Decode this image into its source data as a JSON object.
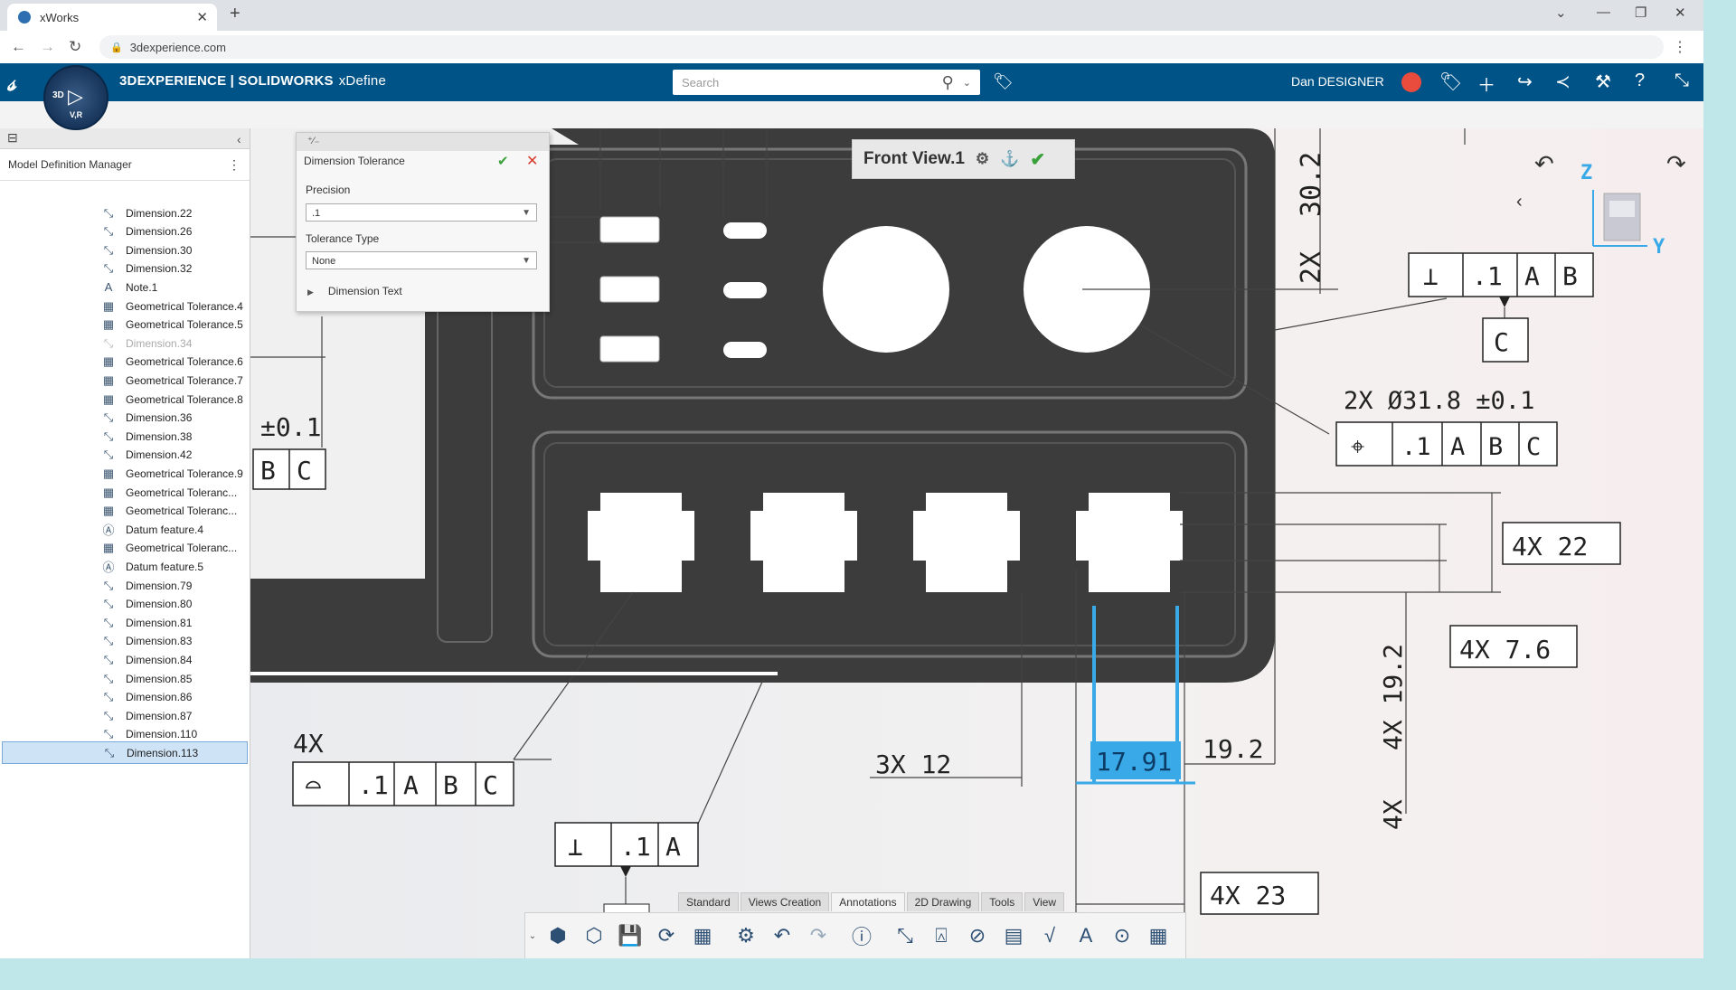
{
  "browser": {
    "tab_title": "xWorks",
    "url": "3dexperience.com"
  },
  "app": {
    "brand_bold": "3DEXPERIENCE | SOLIDWORKS",
    "brand_sub": "xDefine",
    "compass_3d": "3D",
    "compass_vr": "V,R",
    "search_placeholder": "Search",
    "user": "Dan DESIGNER"
  },
  "tree": {
    "title": "Model Definition Manager",
    "items": [
      {
        "label": "Dimension.22",
        "icon": "dimension-icon"
      },
      {
        "label": "Dimension.26",
        "icon": "dimension-icon"
      },
      {
        "label": "Dimension.30",
        "icon": "dimension-icon"
      },
      {
        "label": "Dimension.32",
        "icon": "dimension-icon"
      },
      {
        "label": "Note.1",
        "icon": "note-icon"
      },
      {
        "label": "Geometrical Tolerance.4",
        "icon": "gtol-icon"
      },
      {
        "label": "Geometrical Tolerance.5",
        "icon": "gtol-icon"
      },
      {
        "label": "Dimension.34",
        "icon": "dimension-icon",
        "state": "greyed"
      },
      {
        "label": "Geometrical Tolerance.6",
        "icon": "gtol-icon"
      },
      {
        "label": "Geometrical Tolerance.7",
        "icon": "gtol-icon"
      },
      {
        "label": "Geometrical Tolerance.8",
        "icon": "gtol-icon"
      },
      {
        "label": "Dimension.36",
        "icon": "dimension-icon"
      },
      {
        "label": "Dimension.38",
        "icon": "dimension-icon"
      },
      {
        "label": "Dimension.42",
        "icon": "dimension-icon"
      },
      {
        "label": "Geometrical Tolerance.9",
        "icon": "gtol-icon"
      },
      {
        "label": "Geometrical Toleranc...",
        "icon": "gtol-icon"
      },
      {
        "label": "Geometrical Toleranc...",
        "icon": "gtol-icon"
      },
      {
        "label": "Datum feature.4",
        "icon": "datum-icon"
      },
      {
        "label": "Geometrical Toleranc...",
        "icon": "gtol-icon"
      },
      {
        "label": "Datum feature.5",
        "icon": "datum-icon"
      },
      {
        "label": "Dimension.79",
        "icon": "dimension-icon"
      },
      {
        "label": "Dimension.80",
        "icon": "dimension-icon"
      },
      {
        "label": "Dimension.81",
        "icon": "dimension-icon"
      },
      {
        "label": "Dimension.83",
        "icon": "dimension-icon"
      },
      {
        "label": "Dimension.84",
        "icon": "dimension-icon"
      },
      {
        "label": "Dimension.85",
        "icon": "dimension-icon"
      },
      {
        "label": "Dimension.86",
        "icon": "dimension-icon"
      },
      {
        "label": "Dimension.87",
        "icon": "dimension-icon"
      },
      {
        "label": "Dimension.110",
        "icon": "dimension-icon"
      },
      {
        "label": "Dimension.113",
        "icon": "dimension-icon",
        "state": "selected"
      }
    ]
  },
  "dimension_tolerance": {
    "title": "Dimension Tolerance",
    "precision_label": "Precision",
    "precision_value": ".1",
    "tolerance_type_label": "Tolerance Type",
    "tolerance_type_value": "None",
    "dimension_text_label": "Dimension Text"
  },
  "view": {
    "name": "Front View.1",
    "axis_z": "Z",
    "axis_y": "Y"
  },
  "drawing": {
    "dim_30_2": "30.2",
    "dim_2x_a": "2X",
    "dim_pm01": "±0.1",
    "datum_b": "B",
    "datum_c": "C",
    "datum_a": "A",
    "tol_01": ".1",
    "note_2x_dia": "2X Ø31.8 ±0.1",
    "dim_4x_22": "4X 22",
    "dim_4x_76": "4X 7.6",
    "dim_4x_192": "4X 19.2",
    "dim_4x_23": "4X 23",
    "dim_19_2": "19.2",
    "dim_3x_12": "3X 12",
    "dim_selected": "17.91",
    "label_4x": "4X"
  },
  "toolbar": {
    "tabs": [
      "Standard",
      "Views Creation",
      "Annotations",
      "2D Drawing",
      "Tools",
      "View"
    ],
    "active_tab": "Annotations"
  },
  "colors": {
    "header": "#005386",
    "selection_blue": "#39a9e8",
    "part_fill": "#3c3c3c"
  }
}
